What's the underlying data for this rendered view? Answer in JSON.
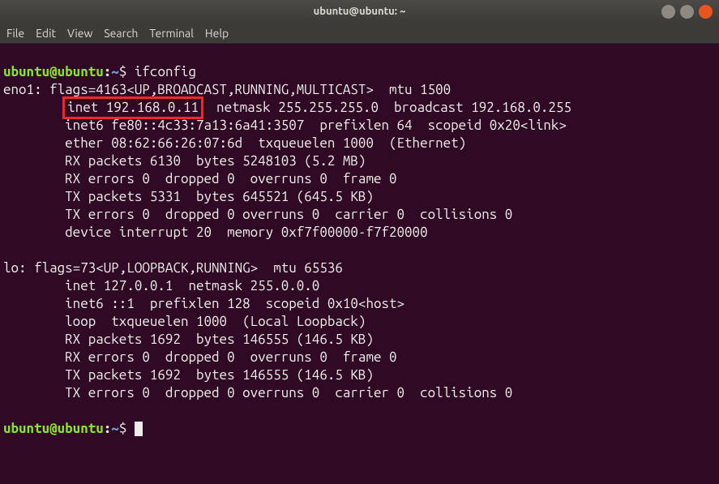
{
  "titlebar": {
    "title": "ubuntu@ubuntu: ~"
  },
  "menu": {
    "file": "File",
    "edit": "Edit",
    "view": "View",
    "search": "Search",
    "terminal": "Terminal",
    "help": "Help"
  },
  "prompt": {
    "userhost": "ubuntu@ubuntu",
    "sep": ":",
    "path": "~",
    "symbol": "$"
  },
  "cmd1": "ifconfig",
  "output": {
    "l1a": "eno1: flags=4163<UP,BROADCAST,RUNNING,MULTICAST>  mtu 1500",
    "l2_pre": "        ",
    "l2_hl": "inet 192.168.0.11",
    "l2_post": "  netmask 255.255.255.0  broadcast 192.168.0.255",
    "l3": "        inet6 fe80::4c33:7a13:6a41:3507  prefixlen 64  scopeid 0x20<link>",
    "l4": "        ether 08:62:66:26:07:6d  txqueuelen 1000  (Ethernet)",
    "l5": "        RX packets 6130  bytes 5248103 (5.2 MB)",
    "l6": "        RX errors 0  dropped 0  overruns 0  frame 0",
    "l7": "        TX packets 5331  bytes 645521 (645.5 KB)",
    "l8": "        TX errors 0  dropped 0 overruns 0  carrier 0  collisions 0",
    "l9": "        device interrupt 20  memory 0xf7f00000-f7f20000",
    "blank1": " ",
    "l10": "lo: flags=73<UP,LOOPBACK,RUNNING>  mtu 65536",
    "l11": "        inet 127.0.0.1  netmask 255.0.0.0",
    "l12": "        inet6 ::1  prefixlen 128  scopeid 0x10<host>",
    "l13": "        loop  txqueuelen 1000  (Local Loopback)",
    "l14": "        RX packets 1692  bytes 146555 (146.5 KB)",
    "l15": "        RX errors 0  dropped 0  overruns 0  frame 0",
    "l16": "        TX packets 1692  bytes 146555 (146.5 KB)",
    "l17": "        TX errors 0  dropped 0 overruns 0  carrier 0  collisions 0",
    "blank2": " "
  }
}
